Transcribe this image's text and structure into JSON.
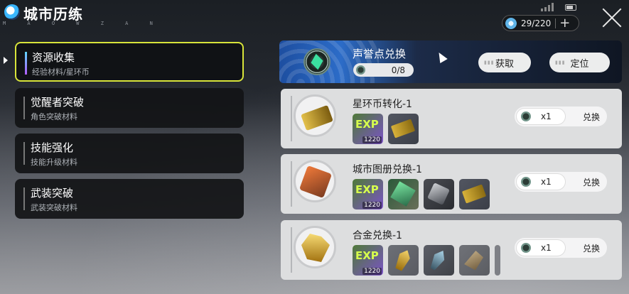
{
  "header": {
    "title": "城市历练",
    "subtitle": "M A O W Z A N",
    "currency_value": "29/220",
    "plus_label": "+"
  },
  "sidebar": {
    "items": [
      {
        "label": "资源收集",
        "desc": "经验材料/星环币",
        "active": true
      },
      {
        "label": "觉醒者突破",
        "desc": "角色突破材料",
        "active": false
      },
      {
        "label": "技能强化",
        "desc": "技能升级材料",
        "active": false
      },
      {
        "label": "武装突破",
        "desc": "武装突破材料",
        "active": false
      }
    ]
  },
  "banner": {
    "title": "声誉点兑换",
    "count": "0/8",
    "get_label": "获取",
    "locate_label": "定位"
  },
  "cards": [
    {
      "name": "星环币转化-1",
      "items": [
        "exp",
        "ticket"
      ],
      "exp_qty": "1220",
      "cost": "x1",
      "action": "兑换"
    },
    {
      "name": "城市图册兑换-1",
      "items": [
        "exp",
        "map",
        "dark",
        "ticket"
      ],
      "exp_qty": "1220",
      "cost": "x1",
      "action": "兑换"
    },
    {
      "name": "合金兑换-1",
      "items": [
        "exp",
        "gold",
        "crystal",
        "stone"
      ],
      "exp_qty": "1220",
      "cost": "x1",
      "action": "兑换"
    }
  ],
  "icons": {
    "logo": "app-logo-icon",
    "currency": "crystal-coin-icon",
    "close": "close-icon",
    "battery": "battery-icon",
    "signal": "signal-icon"
  },
  "colors": {
    "active_border": "#d8e43a",
    "card_bg": "#dddedf",
    "banner_blue": "#2c6cc8"
  }
}
